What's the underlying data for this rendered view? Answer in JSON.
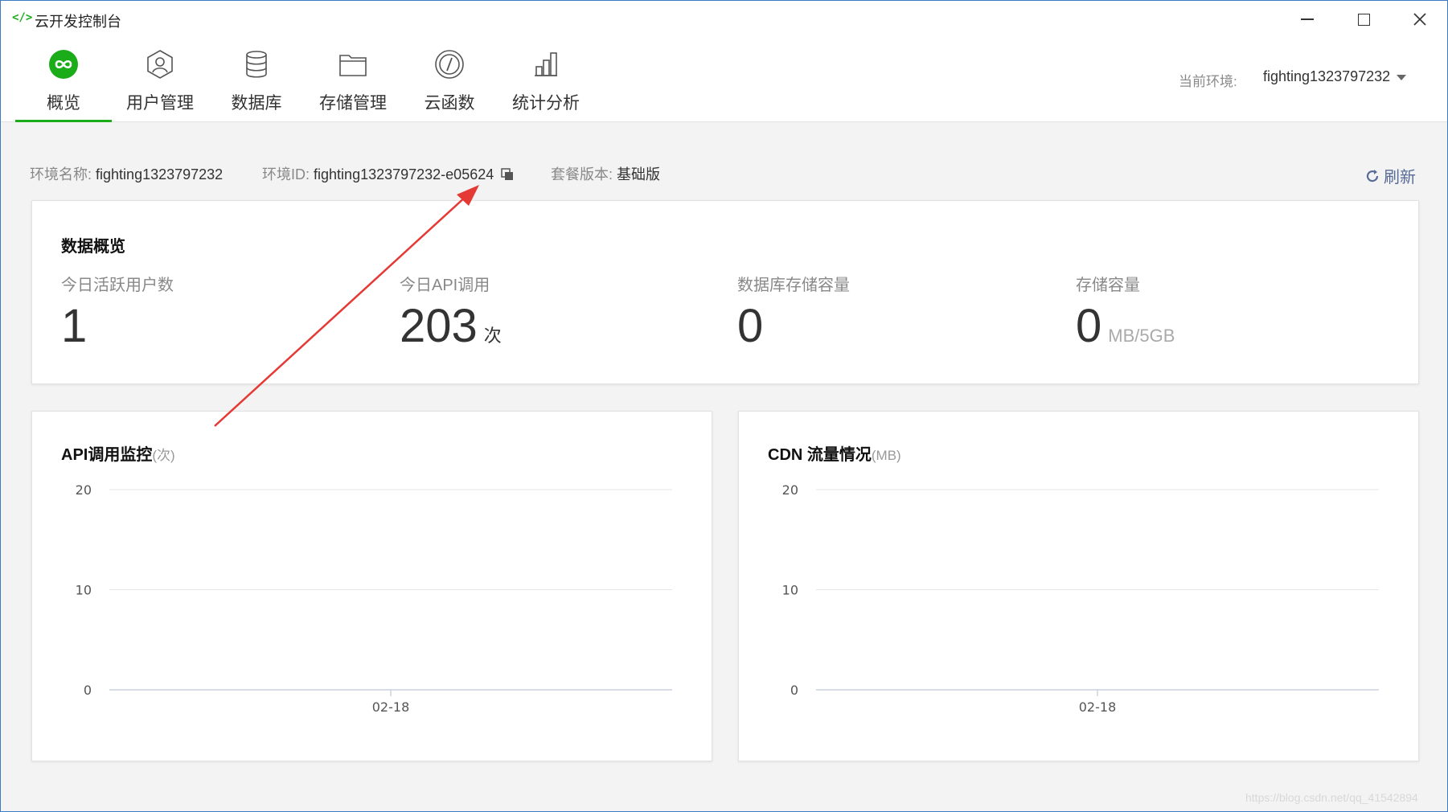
{
  "window": {
    "title": "云开发控制台",
    "icon": "code-brackets-icon"
  },
  "nav": {
    "items": [
      {
        "label": "概览",
        "icon": "infinity-icon",
        "active": true
      },
      {
        "label": "用户管理",
        "icon": "user-icon",
        "active": false
      },
      {
        "label": "数据库",
        "icon": "database-icon",
        "active": false
      },
      {
        "label": "存储管理",
        "icon": "folder-icon",
        "active": false
      },
      {
        "label": "云函数",
        "icon": "function-icon",
        "active": false
      },
      {
        "label": "统计分析",
        "icon": "bar-chart-icon",
        "active": false
      }
    ],
    "env_label": "当前环境:",
    "env_value": "fighting1323797232"
  },
  "info": {
    "env_name_label": "环境名称:",
    "env_name": "fighting1323797232",
    "env_id_label": "环境ID:",
    "env_id": "fighting1323797232-e05624",
    "plan_label": "套餐版本:",
    "plan": "基础版",
    "refresh_label": "刷新"
  },
  "overview": {
    "title": "数据概览",
    "metrics": [
      {
        "label": "今日活跃用户数",
        "value": "1",
        "suffix": ""
      },
      {
        "label": "今日API调用",
        "value": "203",
        "suffix": "次"
      },
      {
        "label": "数据库存储容量",
        "value": "0",
        "suffix": ""
      },
      {
        "label": "存储容量",
        "value": "0",
        "suffix": "MB/5GB"
      }
    ]
  },
  "charts": {
    "api": {
      "title": "API调用监控",
      "unit": "(次)"
    },
    "cdn": {
      "title": "CDN 流量情况",
      "unit": "(MB)"
    }
  },
  "chart_data": [
    {
      "type": "line",
      "title": "API调用监控(次)",
      "x": [
        "02-18"
      ],
      "series": [
        {
          "values": [
            0
          ]
        }
      ],
      "yticks": [
        "0",
        "10",
        "20"
      ],
      "ylim": [
        0,
        20
      ],
      "grid": true
    },
    {
      "type": "line",
      "title": "CDN 流量情况(MB)",
      "x": [
        "02-18"
      ],
      "series": [
        {
          "values": [
            0
          ]
        }
      ],
      "yticks": [
        "0",
        "10",
        "20"
      ],
      "ylim": [
        0,
        20
      ],
      "grid": true
    }
  ],
  "watermark": "https://blog.csdn.net/qq_41542894",
  "colors": {
    "accent": "#1aad19",
    "link": "#576b95",
    "annotation": "#e53935"
  }
}
